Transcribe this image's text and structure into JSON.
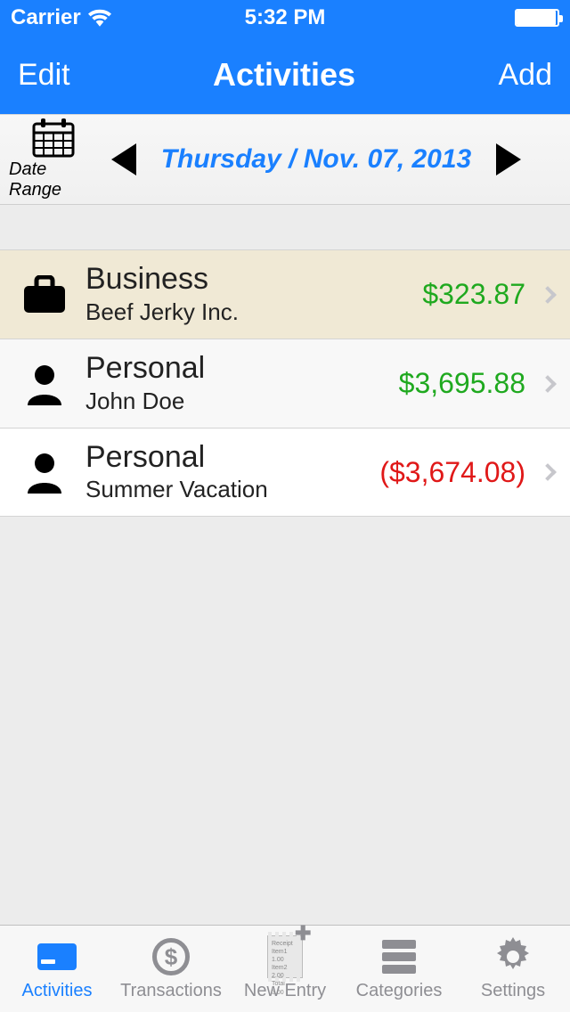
{
  "status": {
    "carrier": "Carrier",
    "time": "5:32 PM"
  },
  "nav": {
    "left": "Edit",
    "title": "Activities",
    "right": "Add"
  },
  "dateBar": {
    "rangeLabel": "Date Range",
    "current": "Thursday / Nov. 07, 2013"
  },
  "activities": [
    {
      "icon": "briefcase",
      "title": "Business",
      "subtitle": "Beef Jerky Inc.",
      "amount": "$323.87",
      "negative": false,
      "selected": true
    },
    {
      "icon": "person",
      "title": "Personal",
      "subtitle": "John Doe",
      "amount": "$3,695.88",
      "negative": false,
      "selected": false
    },
    {
      "icon": "person",
      "title": "Personal",
      "subtitle": "Summer Vacation",
      "amount": "($3,674.08)",
      "negative": true,
      "selected": false
    }
  ],
  "tabs": {
    "activities": "Activities",
    "transactions": "Transactions",
    "newEntry": "New Entry",
    "categories": "Categories",
    "settings": "Settings"
  }
}
